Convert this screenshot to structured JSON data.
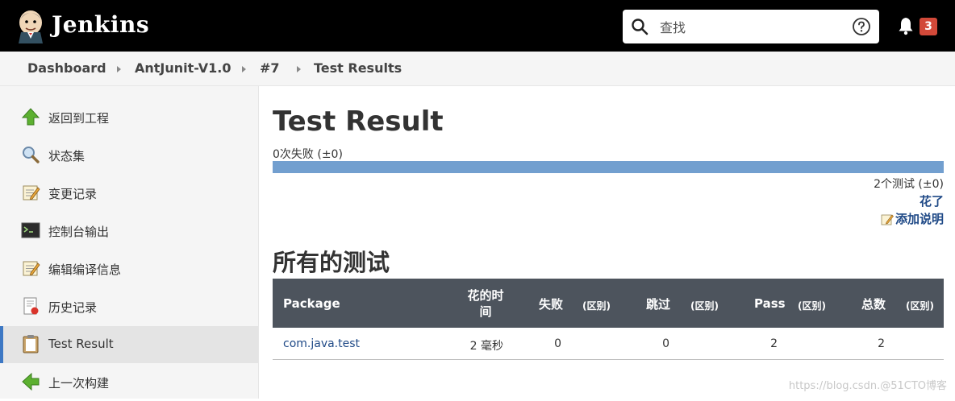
{
  "header": {
    "brand": "Jenkins",
    "search_placeholder": "查找",
    "notification_count": "3"
  },
  "breadcrumbs": [
    "Dashboard",
    "AntJunit-V1.0",
    "#7",
    "Test Results"
  ],
  "sidebar": {
    "items": [
      {
        "label": "返回到工程",
        "icon": "up-arrow-icon"
      },
      {
        "label": "状态集",
        "icon": "magnifier-icon"
      },
      {
        "label": "变更记录",
        "icon": "notepad-icon"
      },
      {
        "label": "控制台输出",
        "icon": "terminal-icon"
      },
      {
        "label": "编辑编译信息",
        "icon": "notepad-icon"
      },
      {
        "label": "历史记录",
        "icon": "history-icon"
      },
      {
        "label": "Test Result",
        "icon": "clipboard-icon"
      },
      {
        "label": "上一次构建",
        "icon": "left-arrow-icon"
      }
    ],
    "active_index": 6
  },
  "main": {
    "title": "Test Result",
    "fail_summary": "0次失败 (±0)",
    "pass_fraction": 1.0,
    "test_count": "2个测试 (±0)",
    "took_link": "花了",
    "add_description": "添加说明",
    "all_tests_heading": "所有的测试"
  },
  "table": {
    "headers": [
      "Package",
      "花的时间",
      "失败",
      "(区别)",
      "跳过",
      "(区别)",
      "Pass",
      "(区别)",
      "总数",
      "(区别)"
    ],
    "rows": [
      {
        "package": "com.java.test",
        "duration": "2 毫秒",
        "fail": "0",
        "skip": "0",
        "pass": "2",
        "total": "2"
      }
    ]
  },
  "watermark": "https://blog.csdn.@51CTO博客",
  "colors": {
    "header_bg": "#000000",
    "accent": "#3d78c4",
    "progress_blue": "#729fcf",
    "table_header_bg": "#4d545d",
    "badge_red": "#d24939",
    "link": "#204a87"
  }
}
